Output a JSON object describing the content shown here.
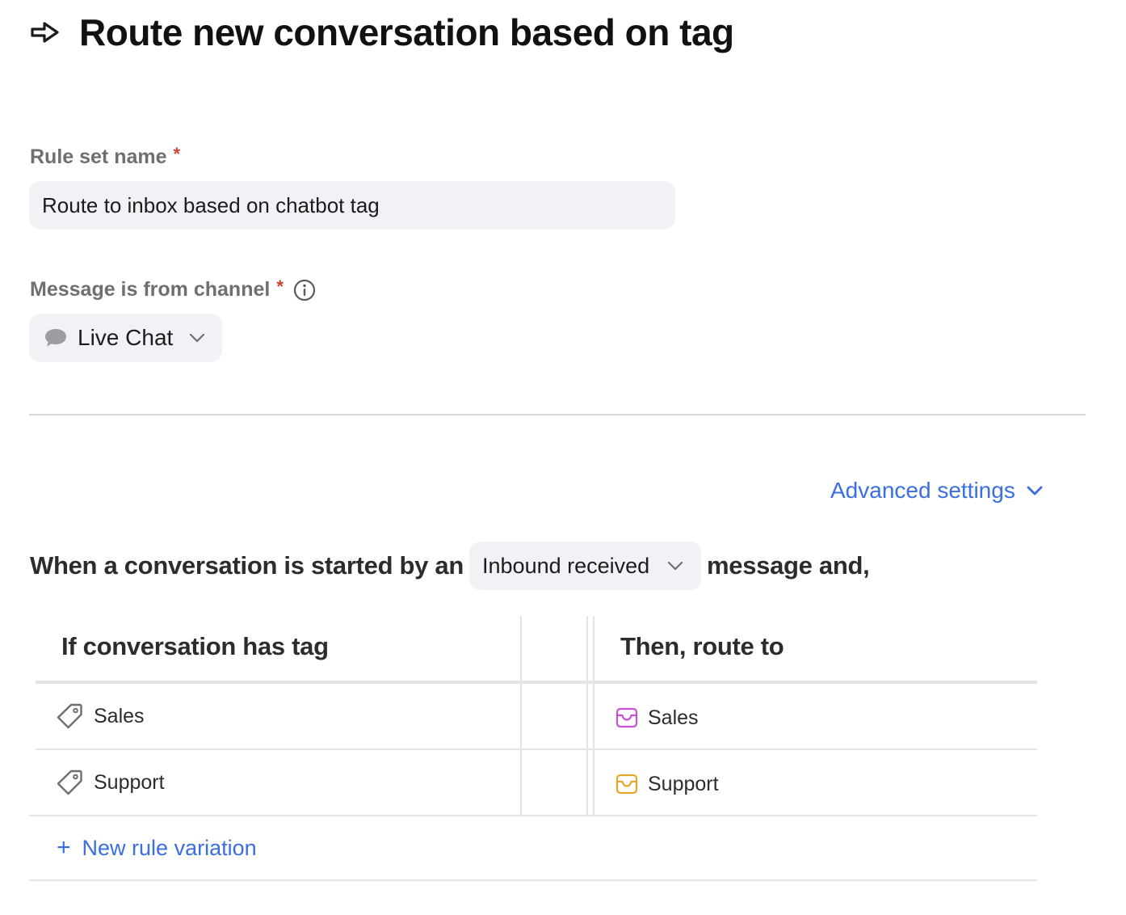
{
  "header": {
    "title": "Route new conversation based on tag",
    "icon": "arrow-right-icon"
  },
  "rule_set_name": {
    "label": "Rule set name",
    "required_mark": "*",
    "value": "Route to inbox based on chatbot tag"
  },
  "channel": {
    "label": "Message is from channel",
    "required_mark": "*",
    "info_icon": "info-icon",
    "selected": "Live Chat",
    "icon": "chat-bubble-icon"
  },
  "advanced_settings": {
    "label": "Advanced settings"
  },
  "trigger": {
    "prefix": "When a conversation is started by an",
    "selected": "Inbound received",
    "suffix": "message and,"
  },
  "rules_table": {
    "columns": [
      "If conversation has tag",
      "Then, route to"
    ],
    "rows": [
      {
        "tag": "Sales",
        "inbox": "Sales",
        "inbox_color": "#c94fd6"
      },
      {
        "tag": "Support",
        "inbox": "Support",
        "inbox_color": "#e0a92a"
      }
    ],
    "add_label": "New rule variation",
    "add_symbol": "+"
  },
  "colors": {
    "accent": "#3a6fe0",
    "required": "#d0402f",
    "input_bg": "#f1f2f5"
  }
}
